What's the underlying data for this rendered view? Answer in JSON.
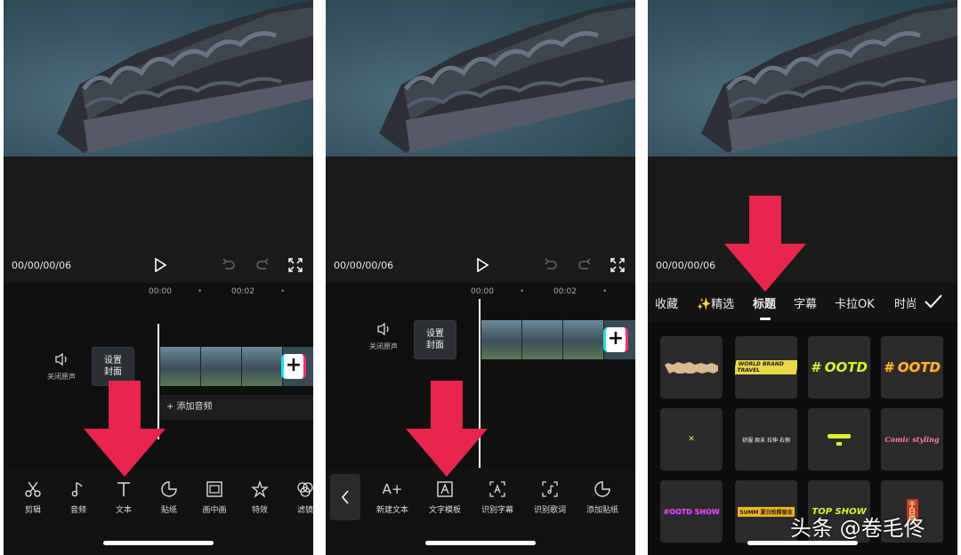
{
  "colors": {
    "accent_arrow": "#e8254c",
    "clip_plus_left": "#1fe0e6",
    "clip_plus_right": "#ff2d6a",
    "lime": "#d8f230",
    "orange": "#ffb340"
  },
  "player": {
    "timecode": "00/00/00/06",
    "icons": [
      "play-icon",
      "undo-icon",
      "redo-icon",
      "fullscreen-icon"
    ]
  },
  "ruler": {
    "t0": "00:00",
    "t1": "00:02",
    "dot": "•"
  },
  "track": {
    "mute_label": "关闭原声",
    "cover_line1": "设置",
    "cover_line2": "封面",
    "add_audio": "+ 添加音频",
    "add_clip": "+"
  },
  "toolbar_main": [
    {
      "label": "剪辑",
      "icon": "scissors-icon"
    },
    {
      "label": "音频",
      "icon": "music-note-icon"
    },
    {
      "label": "文本",
      "icon": "text-icon"
    },
    {
      "label": "贴纸",
      "icon": "sticker-icon"
    },
    {
      "label": "画中画",
      "icon": "picture-in-picture-icon"
    },
    {
      "label": "特效",
      "icon": "effects-star-icon"
    },
    {
      "label": "滤镜",
      "icon": "filter-icon"
    }
  ],
  "toolbar_text": [
    {
      "label": "新建文本",
      "icon": "new-text-icon",
      "glyph": "A+"
    },
    {
      "label": "文字模板",
      "icon": "text-template-icon"
    },
    {
      "label": "识别字幕",
      "icon": "recognize-subtitle-icon"
    },
    {
      "label": "识别歌词",
      "icon": "recognize-lyrics-icon"
    },
    {
      "label": "添加贴纸",
      "icon": "add-sticker-icon"
    }
  ],
  "template_tabs": [
    {
      "label": "收藏"
    },
    {
      "label": "✨精选"
    },
    {
      "label": "标题",
      "active": true
    },
    {
      "label": "字幕"
    },
    {
      "label": "卡拉OK"
    },
    {
      "label": "时尚"
    }
  ],
  "templates": {
    "r1c2": "WORLD BRAND TRAVEL",
    "r1c3": "# OOTD",
    "r1c4": "# OOTD",
    "r2c1": "✕",
    "r2c2": "舒服  周末 拉伸 右側",
    "r2c4": "Comic styling",
    "r3c1": "#OOTD SHOW",
    "r3c2": "SUMM 夏日拍照留念",
    "r3c3": "TOP SHOW",
    "r3c4": "于日常"
  },
  "watermark": "头条 @卷毛佟"
}
